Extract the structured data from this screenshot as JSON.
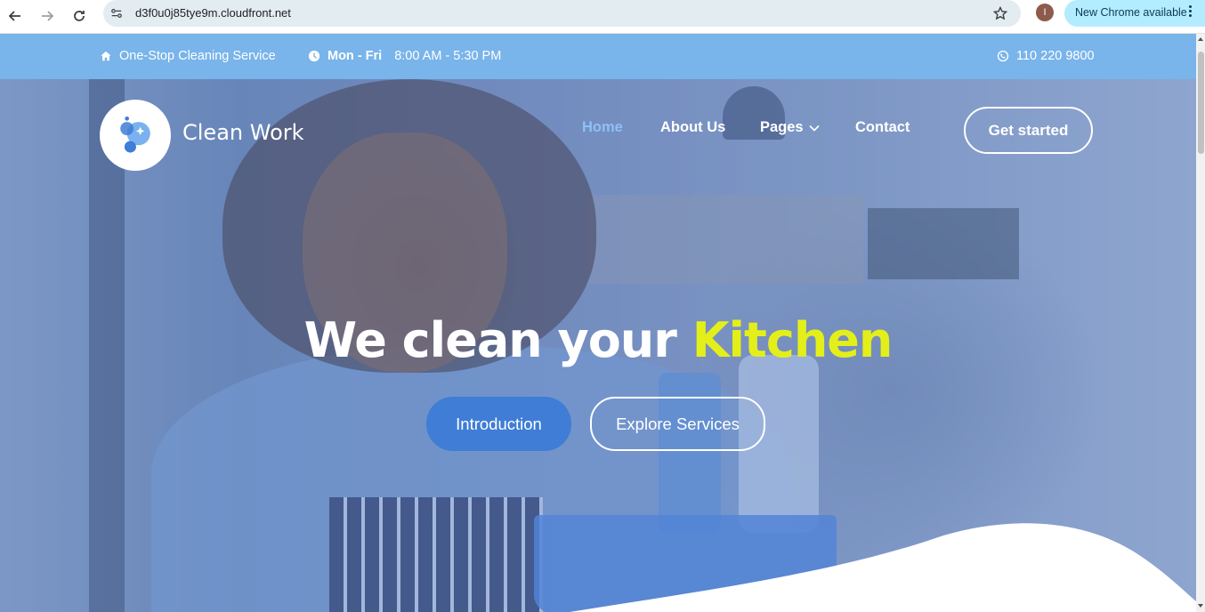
{
  "browser": {
    "url": "d3f0u0j85tye9m.cloudfront.net",
    "avatar_letter": "I",
    "update_label": "New Chrome available"
  },
  "topbar": {
    "service": "One-Stop Cleaning Service",
    "days": "Mon - Fri",
    "hours": "8:00 AM - 5:30 PM",
    "phone": "110 220 9800"
  },
  "nav": {
    "brand": "Clean Work",
    "items": [
      {
        "label": "Home"
      },
      {
        "label": "About Us"
      },
      {
        "label": "Pages"
      },
      {
        "label": "Contact"
      }
    ],
    "cta": "Get started"
  },
  "hero": {
    "headline_main": "We clean your",
    "headline_accent": "Kitchen",
    "btn_primary": "Introduction",
    "btn_secondary": "Explore Services"
  },
  "colors": {
    "topbar": "#79b4ea",
    "accent_yellow": "#e4ef1a",
    "primary_blue": "#3f7dd6",
    "active_nav": "#8ec1f5"
  },
  "icons": [
    "back-arrow-icon",
    "forward-arrow-icon",
    "reload-icon",
    "site-info-icon",
    "star-icon",
    "more-vert-icon",
    "home-icon",
    "clock-icon",
    "whatsapp-icon",
    "chevron-down-icon",
    "bubbles-logo-icon"
  ]
}
